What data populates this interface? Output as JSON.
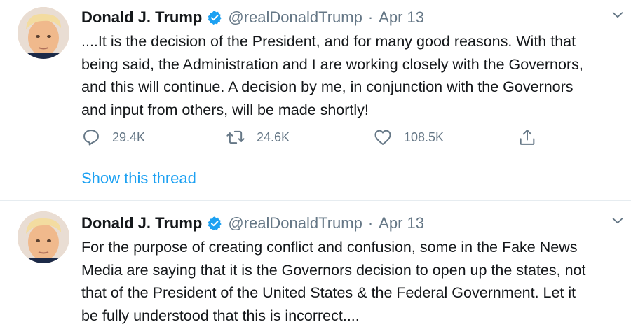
{
  "tweets": [
    {
      "author_name": "Donald J. Trump",
      "handle": "@realDonaldTrump",
      "separator": "·",
      "date": "Apr 13",
      "lines": [
        "....It is the decision of the President, and for many good reasons. With that",
        "being said, the Administration and I are working closely with the Governors,",
        "and this will continue. A decision by me, in conjunction with the Governors",
        "and input from others, will be made shortly!"
      ],
      "replies": "29.4K",
      "retweets": "24.6K",
      "likes": "108.5K",
      "thread_link": "Show this thread"
    },
    {
      "author_name": "Donald J. Trump",
      "handle": "@realDonaldTrump",
      "separator": "·",
      "date": "Apr 13",
      "lines": [
        "For the purpose of creating conflict and confusion, some in the Fake News",
        "Media are saying that it is the Governors decision to open up the states, not",
        "that of the President of the United States & the Federal Government. Let it",
        "be fully understood that this is incorrect...."
      ]
    }
  ],
  "icons": {
    "verified": "verified-badge-icon",
    "chevron": "chevron-down-icon",
    "reply": "reply-icon",
    "retweet": "retweet-icon",
    "like": "heart-icon",
    "share": "share-icon"
  },
  "colors": {
    "accent": "#1da1f2",
    "secondary_text": "#657786",
    "divider": "#e6ecf0"
  }
}
